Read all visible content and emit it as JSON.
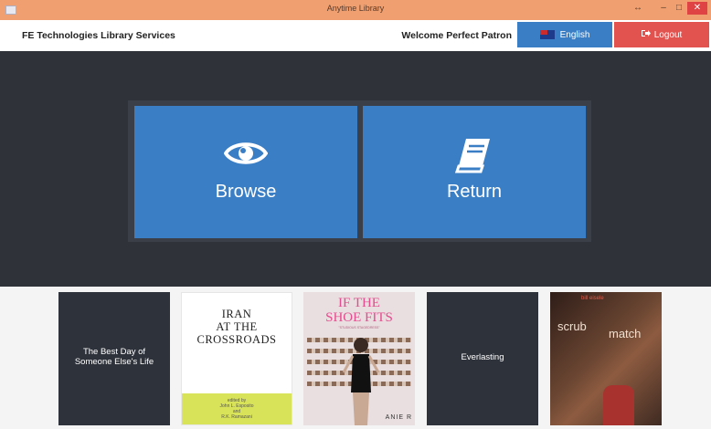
{
  "window": {
    "title": "Anytime Library",
    "pin_glyph": "↔",
    "min_glyph": "–",
    "max_glyph": "□",
    "close_glyph": "✕"
  },
  "header": {
    "brand": "FE Technologies Library Services",
    "welcome": "Welcome Perfect Patron",
    "language_label": "English",
    "language_icon": "australian-flag-icon",
    "logout_label": "Logout",
    "logout_icon": "sign-out-icon"
  },
  "tiles": [
    {
      "label": "Browse",
      "icon": "eye-icon"
    },
    {
      "label": "Return",
      "icon": "book-icon"
    }
  ],
  "books": [
    {
      "title": "The Best Day of Someone Else's Life"
    },
    {
      "title": "Iran at the Crossroads"
    },
    {
      "title": "If the Shoe Fits",
      "author_fragment": "ANIE R"
    },
    {
      "title": "Everlasting"
    },
    {
      "title": "scrub match",
      "author": "bill eisele"
    }
  ],
  "colors": {
    "accent": "#3a7ec6",
    "danger": "#e2524f",
    "stage": "#2f3239",
    "titlebar": "#f0a070"
  }
}
